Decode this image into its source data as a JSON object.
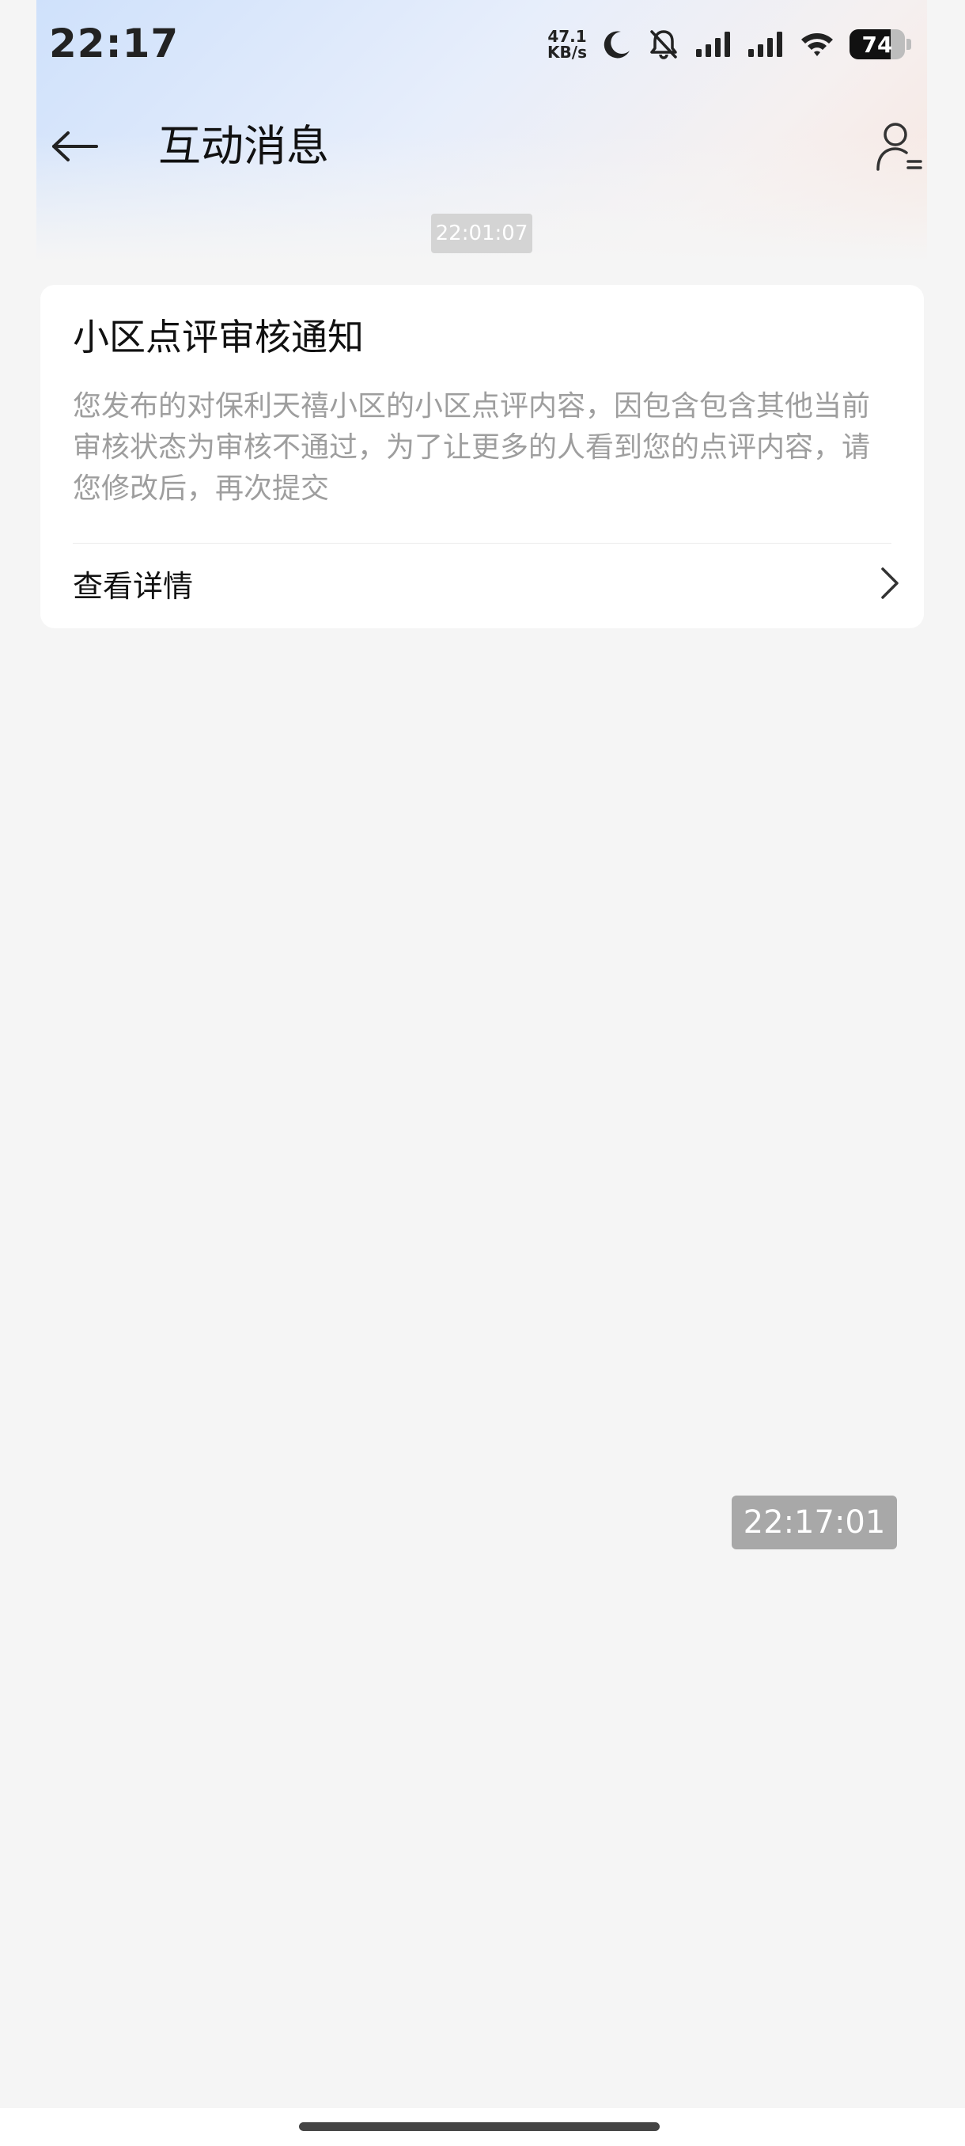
{
  "status_bar": {
    "time": "22:17",
    "net_speed_value": "47.1",
    "net_speed_unit": "KB/s",
    "battery_level": "74",
    "battery_fraction": 0.74,
    "icons": [
      "moon-icon",
      "bell-off-icon",
      "signal-1-icon",
      "signal-2-icon",
      "wifi-icon",
      "battery-icon"
    ]
  },
  "header": {
    "title": "互动消息",
    "back_icon": "arrow-left-icon",
    "profile_icon": "user-settings-icon"
  },
  "messages": {
    "timestamp_top": "22:01:07",
    "timestamp_bottom": "22:17:01"
  },
  "card": {
    "title": "小区点评审核通知",
    "body": "您发布的对保利天禧小区的小区点评内容，因包含包含其他当前审核状态为审核不通过，为了让更多的人看到您的点评内容，请您修改后，再次提交",
    "link_label": "查看详情",
    "link_icon": "chevron-right-icon"
  },
  "colors": {
    "background": "#f5f5f5",
    "card": "#ffffff",
    "muted_text": "#9e9e9e",
    "timestamp_bg": "#a8a8a8"
  }
}
